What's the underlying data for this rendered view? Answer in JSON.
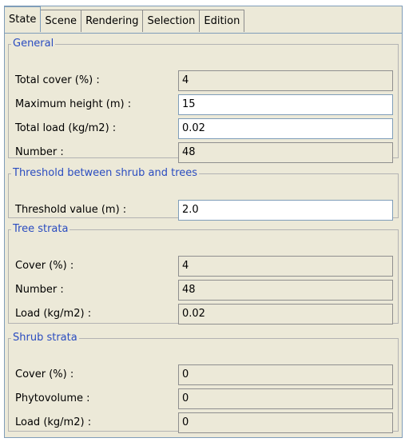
{
  "tabs": [
    {
      "label": "State",
      "active": true
    },
    {
      "label": "Scene",
      "active": false
    },
    {
      "label": "Rendering",
      "active": false
    },
    {
      "label": "Selection",
      "active": false
    },
    {
      "label": "Edition",
      "active": false
    }
  ],
  "groups": {
    "general": {
      "title": "General",
      "rows": [
        {
          "label": "Total cover (%) :",
          "value": "4",
          "editable": false
        },
        {
          "label": "Maximum height (m) :",
          "value": "15",
          "editable": true
        },
        {
          "label": "Total load (kg/m2) :",
          "value": "0.02",
          "editable": true
        },
        {
          "label": "Number :",
          "value": "48",
          "editable": false
        }
      ]
    },
    "threshold": {
      "title": "Threshold between shrub and trees",
      "rows": [
        {
          "label": "Threshold value (m) :",
          "value": "2.0",
          "editable": true
        }
      ]
    },
    "tree": {
      "title": "Tree strata",
      "rows": [
        {
          "label": "Cover (%) :",
          "value": "4",
          "editable": false
        },
        {
          "label": "Number :",
          "value": "48",
          "editable": false
        },
        {
          "label": "Load (kg/m2) :",
          "value": "0.02",
          "editable": false
        }
      ]
    },
    "shrub": {
      "title": "Shrub strata",
      "rows": [
        {
          "label": "Cover (%) :",
          "value": "0",
          "editable": false
        },
        {
          "label": "Phytovolume :",
          "value": "0",
          "editable": false
        },
        {
          "label": "Load (kg/m2) :",
          "value": "0",
          "editable": false
        }
      ]
    }
  },
  "colors": {
    "panel": "#ece9d8",
    "legend": "#2a4cc0",
    "border": "#7f9db9"
  }
}
